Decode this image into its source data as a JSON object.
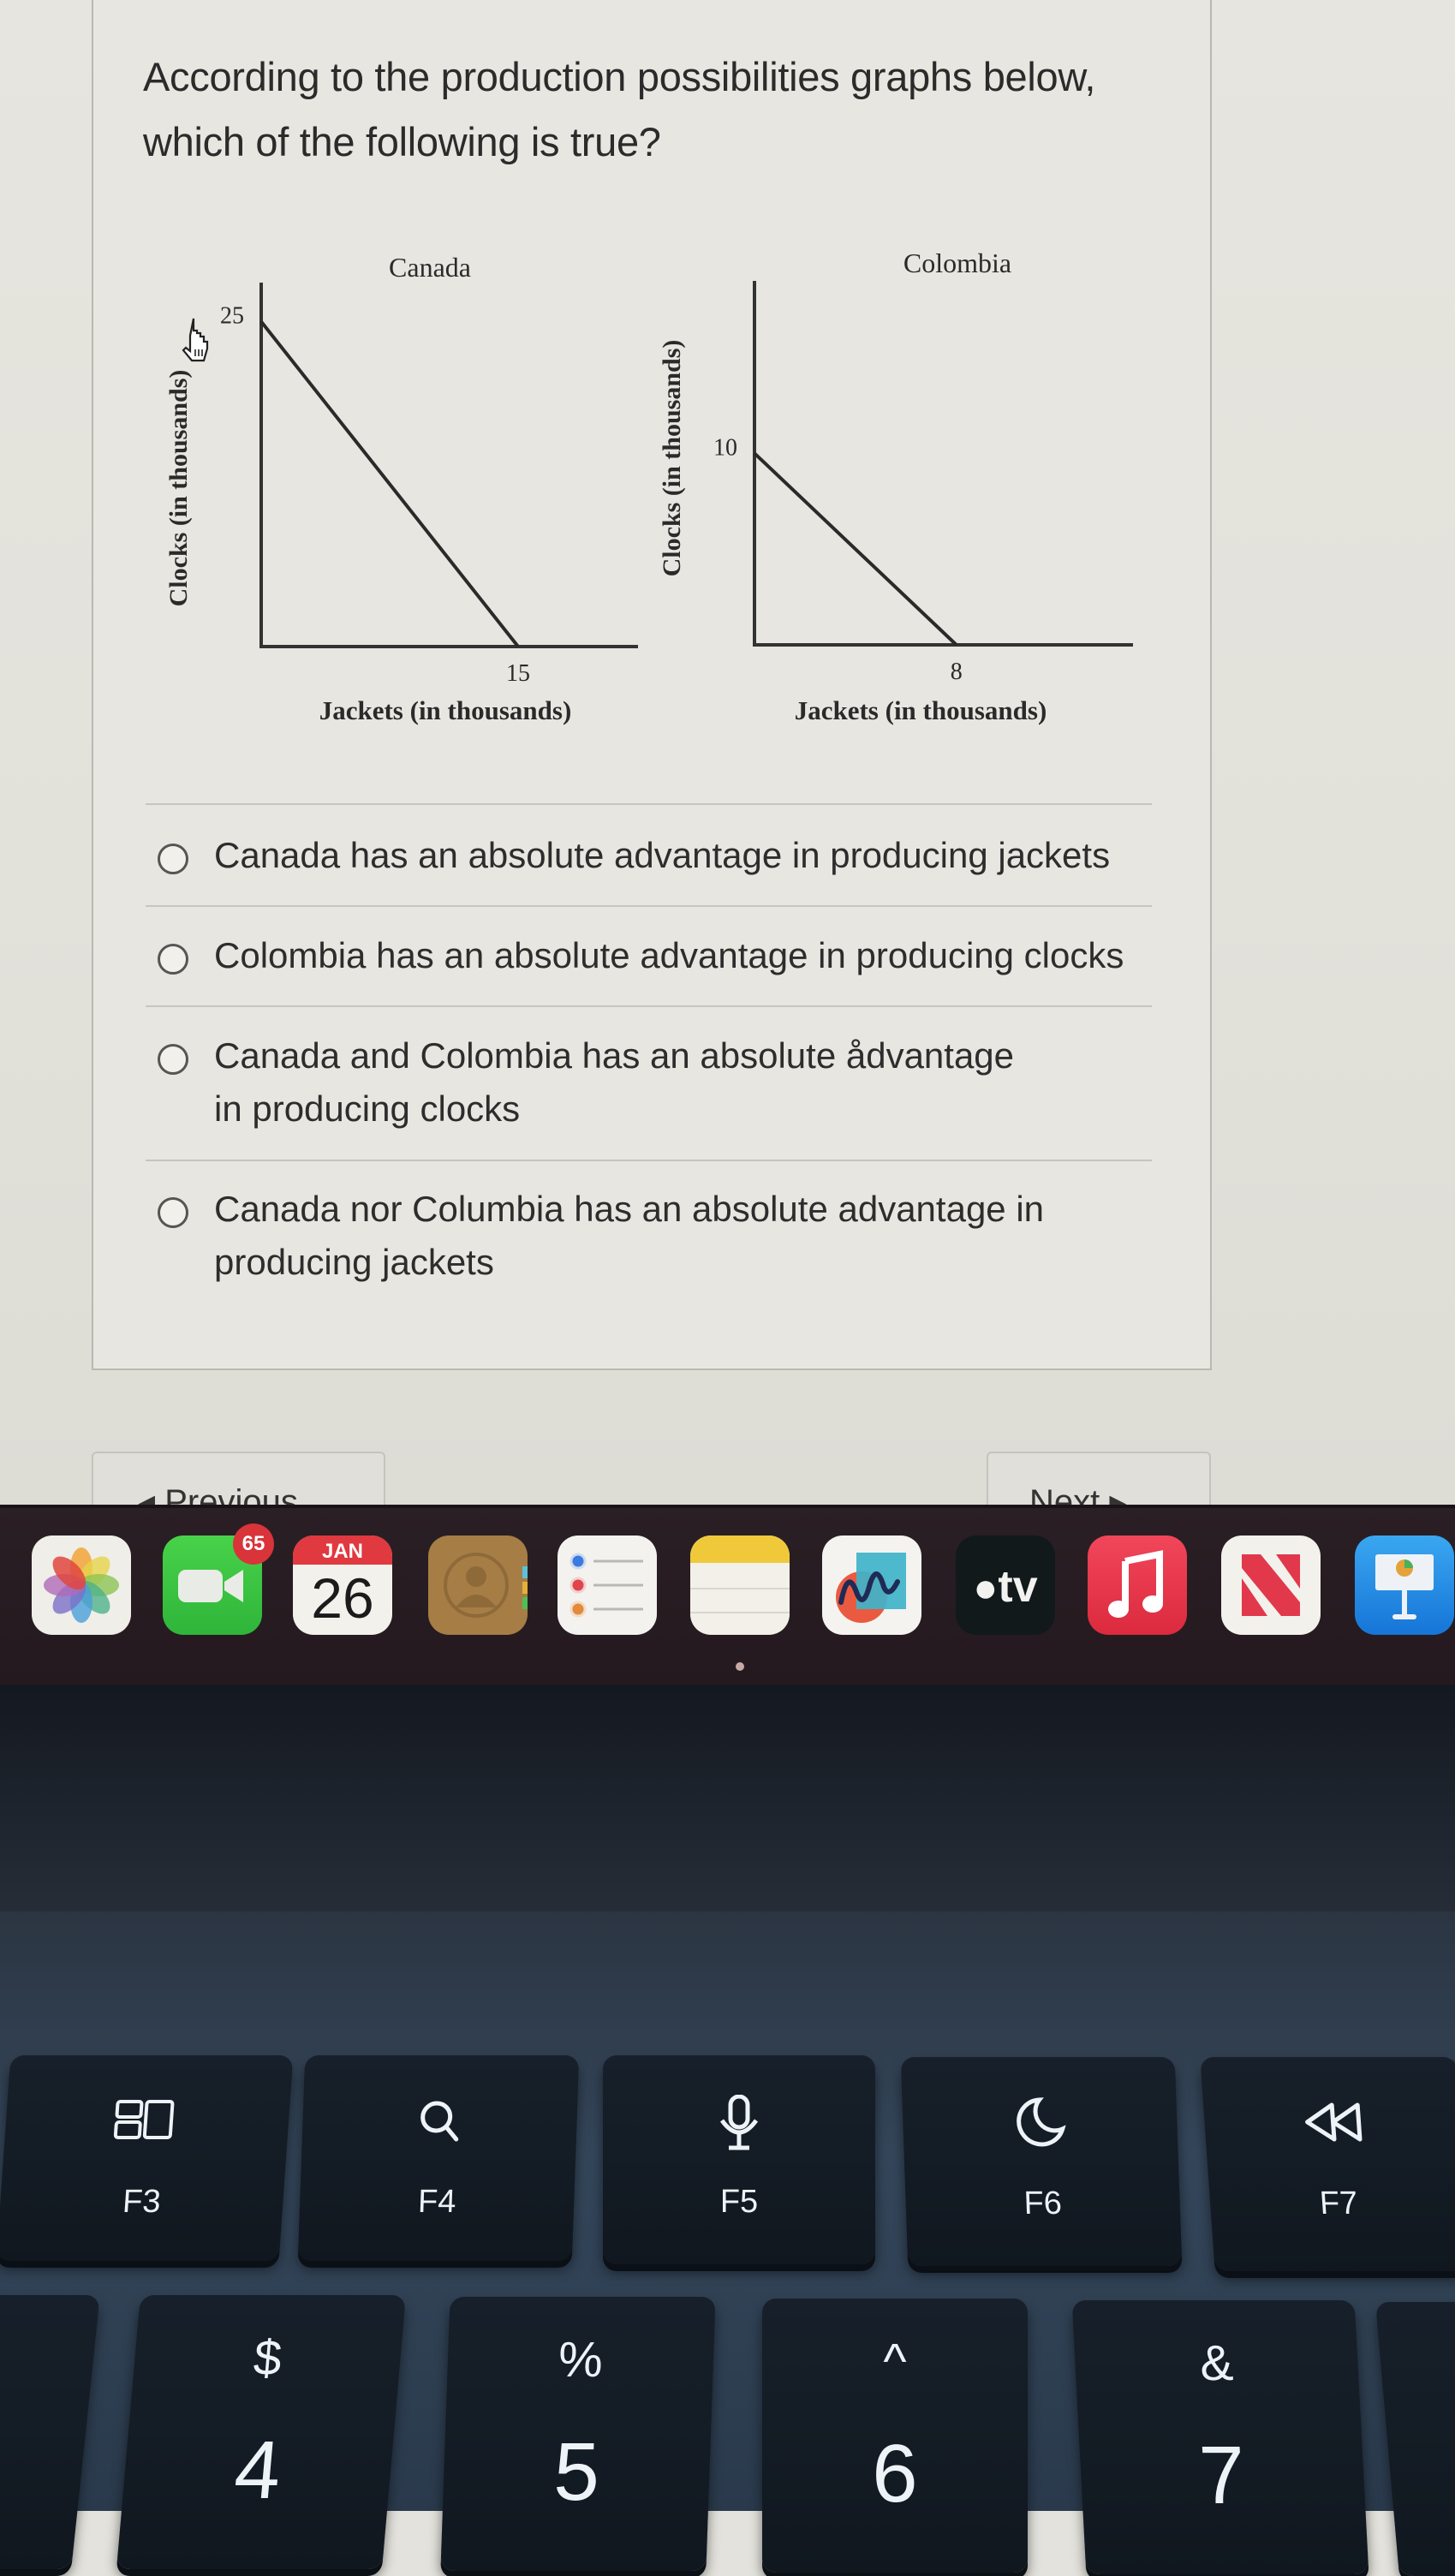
{
  "question": {
    "text": "According to the production possibilities graphs below, which of the following is true?"
  },
  "chart_data": [
    {
      "type": "line",
      "title": "Canada",
      "xlabel": "Jackets (in thousands)",
      "ylabel": "Clocks (in thousands)",
      "x": [
        0,
        15
      ],
      "y": [
        25,
        0
      ],
      "x_tick_labels": [
        "15"
      ],
      "y_tick_labels": [
        "25"
      ],
      "xlim": [
        0,
        22
      ],
      "ylim": [
        0,
        28
      ],
      "grid": false
    },
    {
      "type": "line",
      "title": "Colombia",
      "xlabel": "Jackets (in thousands)",
      "ylabel": "Clocks (in thousands)",
      "x": [
        0,
        8
      ],
      "y": [
        10,
        0
      ],
      "x_tick_labels": [
        "8"
      ],
      "y_tick_labels": [
        "10"
      ],
      "xlim": [
        0,
        15
      ],
      "ylim": [
        0,
        19
      ],
      "grid": false
    }
  ],
  "options": [
    {
      "label": "Canada has an absolute advantage in producing jackets",
      "selected": false
    },
    {
      "label": "Colombia has an absolute advantage in producing clocks",
      "selected": false
    },
    {
      "label": "Canada and Colombia has an absolute ådvantage in producing clocks",
      "selected": false
    },
    {
      "label": "Canada nor Columbia has an absolute advantage in producing jackets",
      "selected": false
    }
  ],
  "nav": {
    "previous_label": "◂ Previous",
    "next_label": "Next ▸"
  },
  "dock": {
    "apps": [
      {
        "name": "Photos",
        "icon": "photos-icon"
      },
      {
        "name": "FaceTime",
        "icon": "facetime-icon",
        "badge": "65"
      },
      {
        "name": "Calendar",
        "icon": "calendar-icon",
        "month": "JAN",
        "day": "26"
      },
      {
        "name": "Contacts",
        "icon": "contacts-icon"
      },
      {
        "name": "Reminders",
        "icon": "reminders-icon"
      },
      {
        "name": "Notes",
        "icon": "notes-icon"
      },
      {
        "name": "Freeform",
        "icon": "freeform-icon"
      },
      {
        "name": "TV",
        "icon": "appletv-icon",
        "text": "tv"
      },
      {
        "name": "Music",
        "icon": "music-icon"
      },
      {
        "name": "News",
        "icon": "news-icon"
      },
      {
        "name": "Keynote",
        "icon": "keynote-icon"
      }
    ]
  },
  "keyboard": {
    "function_keys": [
      {
        "label": "F3",
        "icon": "mission-control-icon"
      },
      {
        "label": "F4",
        "icon": "search-icon"
      },
      {
        "label": "F5",
        "icon": "microphone-icon"
      },
      {
        "label": "F6",
        "icon": "moon-icon"
      },
      {
        "label": "F7",
        "icon": "rewind-icon"
      }
    ],
    "number_keys": [
      {
        "top": "$",
        "bottom": "4"
      },
      {
        "top": "%",
        "bottom": "5"
      },
      {
        "top": "^",
        "bottom": "6"
      },
      {
        "top": "&",
        "bottom": "7"
      }
    ]
  },
  "colors": {
    "dock_bg": "#24191e",
    "badge": "#d8343a",
    "key": "#10171f"
  }
}
